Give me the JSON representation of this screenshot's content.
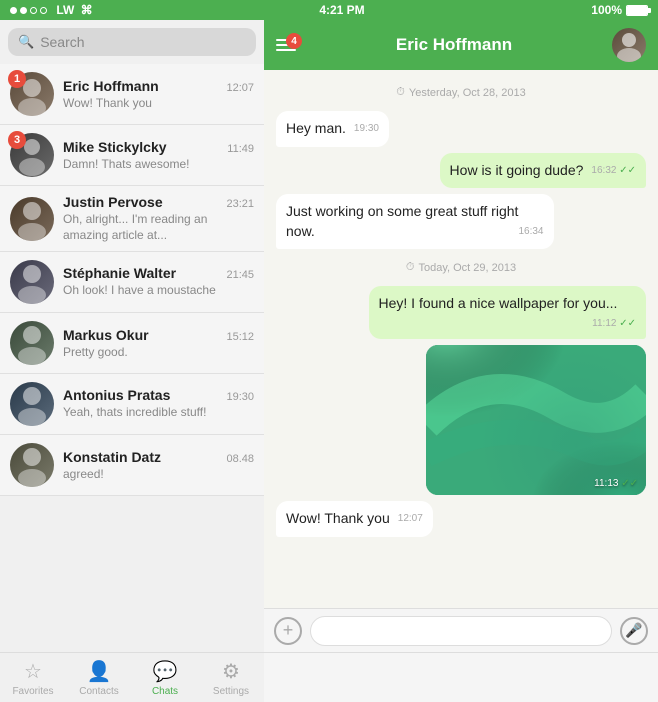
{
  "statusBar": {
    "signals": [
      "filled",
      "filled",
      "empty",
      "empty"
    ],
    "carrier": "LW",
    "time": "4:21 PM",
    "battery": "100%"
  },
  "search": {
    "placeholder": "Search"
  },
  "chatList": {
    "items": [
      {
        "id": "eric",
        "name": "Eric Hoffmann",
        "time": "12:07",
        "preview": "Wow! Thank you",
        "badge": "1",
        "avatarClass": "av-eric"
      },
      {
        "id": "mike",
        "name": "Mike Stickylcky",
        "time": "11:49",
        "preview": "Damn! Thats awesome!",
        "badge": "3",
        "avatarClass": "av-mike"
      },
      {
        "id": "justin",
        "name": "Justin Pervose",
        "time": "23:21",
        "preview": "Oh, alright... I'm reading an amazing article at...",
        "badge": null,
        "avatarClass": "av-justin"
      },
      {
        "id": "stephanie",
        "name": "Stéphanie Walter",
        "time": "21:45",
        "preview": "Oh look! I have a moustache",
        "badge": null,
        "avatarClass": "av-stephanie"
      },
      {
        "id": "markus",
        "name": "Markus Okur",
        "time": "15:12",
        "preview": "Pretty good.",
        "badge": null,
        "avatarClass": "av-markus"
      },
      {
        "id": "antonius",
        "name": "Antonius Pratas",
        "time": "19:30",
        "preview": "Yeah, thats incredible stuff!",
        "badge": null,
        "avatarClass": "av-antonius"
      },
      {
        "id": "konstatin",
        "name": "Konstatin Datz",
        "time": "08.48",
        "preview": "agreed!",
        "badge": null,
        "avatarClass": "av-konstatin"
      }
    ]
  },
  "chatHeader": {
    "menuBadge": "4",
    "contactName": "Eric Hoffmann"
  },
  "messages": {
    "date1": "Yesterday, Oct 28, 2013",
    "date2": "Today, Oct 29, 2013",
    "items": [
      {
        "type": "received",
        "text": "Hey man.",
        "time": "19:30",
        "ticks": ""
      },
      {
        "type": "sent",
        "text": "How is it going dude?",
        "time": "16:32",
        "ticks": "✓✓"
      },
      {
        "type": "received",
        "text": "Just working on some great stuff right now.",
        "time": "16:34",
        "ticks": ""
      },
      {
        "type": "sent",
        "text": "Hey! I found a nice wallpaper for you...",
        "time": "11:12",
        "ticks": "✓✓"
      },
      {
        "type": "image",
        "time": "11:13",
        "ticks": "✓✓"
      },
      {
        "type": "received",
        "text": "Wow! Thank you",
        "time": "12:07",
        "ticks": ""
      }
    ]
  },
  "inputBar": {
    "placeholder": ""
  },
  "bottomNav": {
    "items": [
      {
        "id": "favorites",
        "label": "Favorites",
        "icon": "☆",
        "active": false
      },
      {
        "id": "contacts",
        "label": "Contacts",
        "icon": "👤",
        "active": false
      },
      {
        "id": "chats",
        "label": "Chats",
        "icon": "💬",
        "active": true
      },
      {
        "id": "settings",
        "label": "Settings",
        "icon": "⚙",
        "active": false
      }
    ]
  }
}
